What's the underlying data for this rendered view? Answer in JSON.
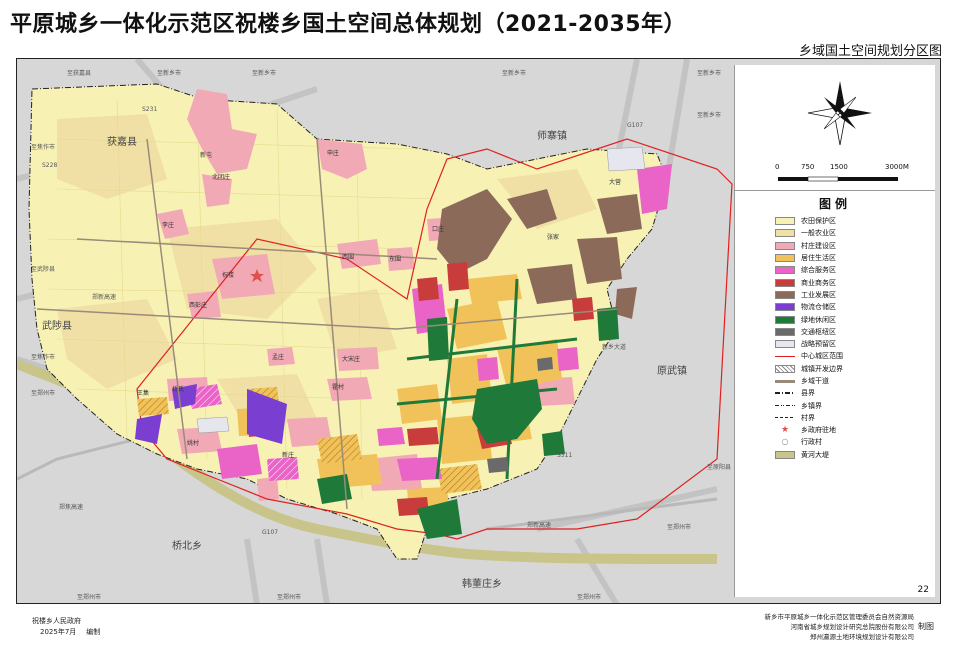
{
  "header": {
    "title": "平原城乡一体化示范区祝楼乡国土空间总体规划（2021-2035年）",
    "subtitle": "乡域国土空间规划分区图"
  },
  "map": {
    "labels": {
      "huojia": "获嘉县",
      "shizhai": "师寨镇",
      "wuzhi": "武陟县",
      "yuanwu": "原武镇",
      "qiaobei": "桥北乡",
      "handong": "韩董庄乡",
      "zhulou": "祝楼",
      "xiwei": "西围",
      "dongwei": "东围",
      "kouzhuang": "口庄",
      "mengzhuang": "孟庄",
      "xipeng": "西彭庄",
      "qiaoshi": "桥氏",
      "yaocun": "姚村",
      "xinzhuang": "新庄",
      "lizhuang": "李庄",
      "shenzhuang": "申庄",
      "beituan": "北团庄",
      "xiancun": "大宋庄",
      "xintun": "新屯",
      "shuangfu": "霍村",
      "zhangjia": "张家",
      "daying": "大营",
      "wangji": "王集"
    },
    "roads": {
      "s231": "S231",
      "s228": "S228",
      "s311": "S311",
      "g107a": "G107",
      "g107b": "G107",
      "to_huojia": "至获嘉县",
      "to_xinxiang1": "至新乡市",
      "to_xinxiang2": "至新乡市",
      "to_xinxiang3": "至新乡市",
      "to_xinxiang4": "至新乡市",
      "to_xinxiang5": "至新乡市",
      "to_jiaozuo1": "至焦作市",
      "to_jiaozuo2": "至焦作市",
      "to_wuzhi": "至武陟县",
      "to_zhengzhou1": "至郑州市",
      "to_zhengzhou2": "至郑州市",
      "to_zhengzhou3": "至郑州市",
      "to_zhengzhou4": "至郑州市",
      "to_zhengzhou5": "至郑州市",
      "to_yuanyang": "至原阳县",
      "gaosu1": "郑新高速",
      "gaosu2": "郑新高速",
      "gaosu3": "郑焦高速",
      "street": "新乡大道"
    }
  },
  "scale": {
    "labels": [
      "0",
      "750",
      "1500",
      "3000M"
    ]
  },
  "legend": {
    "title": "图例",
    "items": [
      {
        "label": "农田保护区",
        "color": "#f7f2b4",
        "pattern": "fill"
      },
      {
        "label": "一般农业区",
        "color": "#f0e0a6",
        "pattern": "fill"
      },
      {
        "label": "村庄建设区",
        "color": "#f2a9b6",
        "pattern": "fill"
      },
      {
        "label": "居住生活区",
        "color": "#f1c25a",
        "pattern": "fill"
      },
      {
        "label": "综合服务区",
        "color": "#ea64c8",
        "pattern": "fill"
      },
      {
        "label": "商业商务区",
        "color": "#c83c3c",
        "pattern": "fill"
      },
      {
        "label": "工业发展区",
        "color": "#8c6a5a",
        "pattern": "fill"
      },
      {
        "label": "物流仓储区",
        "color": "#7a3ed0",
        "pattern": "fill"
      },
      {
        "label": "绿地休闲区",
        "color": "#1f7a3a",
        "pattern": "fill"
      },
      {
        "label": "交通枢纽区",
        "color": "#6a6a6a",
        "pattern": "fill"
      },
      {
        "label": "战略预留区",
        "color": "#e6e6ee",
        "pattern": "fill"
      },
      {
        "label": "中心城区范围",
        "color": "#e02020",
        "pattern": "redline"
      },
      {
        "label": "城镇开发边界",
        "color": "#888888",
        "pattern": "hatch"
      },
      {
        "label": "乡域干道",
        "color": "#9a8a7a",
        "pattern": "road"
      },
      {
        "label": "县界",
        "color": "#222222",
        "pattern": "dashdot"
      },
      {
        "label": "乡镇界",
        "color": "#222222",
        "pattern": "dashdot2"
      },
      {
        "label": "村界",
        "color": "#222222",
        "pattern": "dash"
      },
      {
        "label": "乡政府驻地",
        "color": "#e0504a",
        "pattern": "star"
      },
      {
        "label": "行政村",
        "color": "#888888",
        "pattern": "circle"
      },
      {
        "label": "黄河大堤",
        "color": "#c8c48a",
        "pattern": "fill"
      }
    ]
  },
  "page_number": "22",
  "footer": {
    "left_line1": "祝楼乡人民政府",
    "left_date": "2025年7月",
    "left_bianzhi": "编制",
    "right_line1": "新乡市平原城乡一体化示范区管理委员会自然资源局",
    "right_line2": "河南省城乡规划设计研究总院股份有限公司",
    "right_line3": "郑州瀛源土地环境规划设计有限公司",
    "right_zhitu": "制图"
  },
  "colors": {
    "farmland": "#f7f2b4",
    "general_ag": "#f0e0a6",
    "village": "#f2a9b6",
    "residential": "#f1c25a",
    "service": "#ea64c8",
    "commercial": "#c83c3c",
    "industry": "#8c6a5a",
    "logistics": "#7a3ed0",
    "green": "#1f7a3a",
    "transport": "#6a6a6a",
    "reserve": "#e6e6ee",
    "dike": "#c8c48a",
    "outside": "#d7d7d7"
  }
}
